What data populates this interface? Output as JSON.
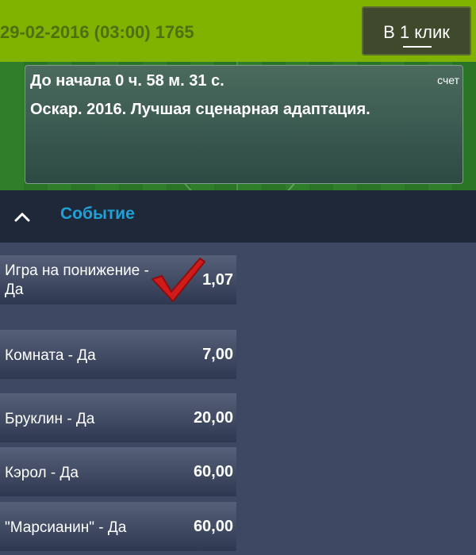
{
  "header": {
    "date_text": "29-02-2016 (03:00) 1765",
    "one_click_label": "В 1 клик"
  },
  "event_card": {
    "countdown": "До начала 0 ч. 58 м. 31 с.",
    "score_label": "счет",
    "title": "Оскар. 2016. Лучшая сценарная адаптация."
  },
  "section": {
    "label": "Событие"
  },
  "odds": [
    {
      "name": "Игра на понижение - Да",
      "value": "1,07",
      "selected": true
    },
    {
      "name": "Комната - Да",
      "value": "7,00"
    },
    {
      "name": "Бруклин - Да",
      "value": "20,00"
    },
    {
      "name": "Кэрол - Да",
      "value": "60,00"
    },
    {
      "name": "\"Марсианин\" - Да",
      "value": "60,00"
    }
  ],
  "colors": {
    "header_green": "#7fb300",
    "accent_blue": "#1fa0d6",
    "checkmark_red": "#d11a1a"
  }
}
